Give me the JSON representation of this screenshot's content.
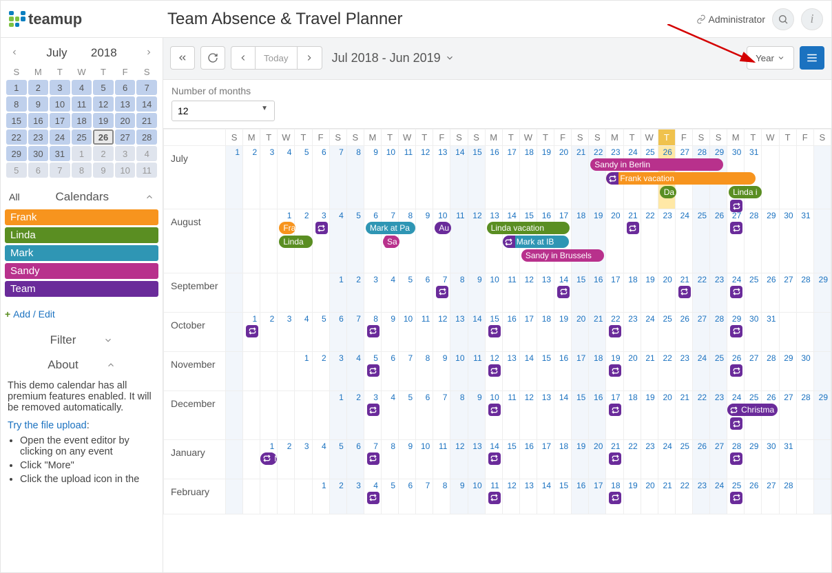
{
  "brand": "teamup",
  "title": "Team Absence & Travel Planner",
  "admin_label": "Administrator",
  "toolbar": {
    "today": "Today",
    "range": "Jul 2018 - Jun 2019",
    "view": "Year"
  },
  "months_bar": {
    "label": "Number of months",
    "value": "12"
  },
  "mini_cal": {
    "month": "July",
    "year": "2018",
    "dow": [
      "S",
      "M",
      "T",
      "W",
      "T",
      "F",
      "S"
    ],
    "weeks": [
      [
        {
          "n": 1,
          "c": "in"
        },
        {
          "n": 2,
          "c": "in"
        },
        {
          "n": 3,
          "c": "in"
        },
        {
          "n": 4,
          "c": "in"
        },
        {
          "n": 5,
          "c": "in"
        },
        {
          "n": 6,
          "c": "in"
        },
        {
          "n": 7,
          "c": "in"
        }
      ],
      [
        {
          "n": 8,
          "c": "in"
        },
        {
          "n": 9,
          "c": "in"
        },
        {
          "n": 10,
          "c": "in"
        },
        {
          "n": 11,
          "c": "in"
        },
        {
          "n": 12,
          "c": "in"
        },
        {
          "n": 13,
          "c": "in"
        },
        {
          "n": 14,
          "c": "in"
        }
      ],
      [
        {
          "n": 15,
          "c": "in"
        },
        {
          "n": 16,
          "c": "in"
        },
        {
          "n": 17,
          "c": "in"
        },
        {
          "n": 18,
          "c": "in"
        },
        {
          "n": 19,
          "c": "in"
        },
        {
          "n": 20,
          "c": "in"
        },
        {
          "n": 21,
          "c": "in"
        }
      ],
      [
        {
          "n": 22,
          "c": "in"
        },
        {
          "n": 23,
          "c": "in"
        },
        {
          "n": 24,
          "c": "in"
        },
        {
          "n": 25,
          "c": "in"
        },
        {
          "n": 26,
          "c": "today"
        },
        {
          "n": 27,
          "c": "in"
        },
        {
          "n": 28,
          "c": "in"
        }
      ],
      [
        {
          "n": 29,
          "c": "in"
        },
        {
          "n": 30,
          "c": "in"
        },
        {
          "n": 31,
          "c": "in"
        },
        {
          "n": 1,
          "c": "out"
        },
        {
          "n": 2,
          "c": "out"
        },
        {
          "n": 3,
          "c": "out"
        },
        {
          "n": 4,
          "c": "out"
        }
      ],
      [
        {
          "n": 5,
          "c": "out"
        },
        {
          "n": 6,
          "c": "out"
        },
        {
          "n": 7,
          "c": "out"
        },
        {
          "n": 8,
          "c": "out"
        },
        {
          "n": 9,
          "c": "out"
        },
        {
          "n": 10,
          "c": "out"
        },
        {
          "n": 11,
          "c": "out"
        }
      ]
    ]
  },
  "calendars_label": "Calendars",
  "all_label": "All",
  "calendars": [
    {
      "name": "Frank",
      "cls": "cal-frank"
    },
    {
      "name": "Linda",
      "cls": "cal-linda"
    },
    {
      "name": "Mark",
      "cls": "cal-mark"
    },
    {
      "name": "Sandy",
      "cls": "cal-sandy"
    },
    {
      "name": "Team",
      "cls": "cal-team"
    }
  ],
  "add_edit": "Add / Edit",
  "filter_label": "Filter",
  "about_label": "About",
  "about_text": "This demo calendar has all premium features enabled. It will be removed automatically.",
  "about_link": "Try the file upload",
  "about_items": [
    "Open the event editor by clicking on any event",
    "Click \"More\"",
    "Click the upload icon in the"
  ],
  "dow_header": [
    "S",
    "M",
    "T",
    "W",
    "T",
    "F",
    "S",
    "S",
    "M",
    "T",
    "W",
    "T",
    "F",
    "S",
    "S",
    "M",
    "T",
    "W",
    "T",
    "F",
    "S",
    "S",
    "M",
    "T",
    "W",
    "T",
    "F",
    "S",
    "S",
    "M",
    "T",
    "W",
    "T",
    "F",
    "S"
  ],
  "year_rows": [
    {
      "month": "July",
      "offset": 0,
      "days": 31,
      "today": 26,
      "tall": 3.2,
      "events": [
        {
          "label": "Sandy in Berlin",
          "start": 22,
          "span": 8,
          "row": 0,
          "color": "#b8318c"
        },
        {
          "label": "Frank vacation",
          "start": 23,
          "span": 9,
          "row": 1,
          "color": "#f7941e",
          "prependRpt": true
        },
        {
          "label": "Da",
          "start": 26,
          "span": 1,
          "row": 2,
          "color": "#5a8e22"
        },
        {
          "label": "Linda i",
          "start": 30,
          "span": 2,
          "row": 2,
          "color": "#5a8e22"
        }
      ],
      "rpt": [
        {
          "col": 30,
          "row": 3
        }
      ]
    },
    {
      "month": "August",
      "offset": 3,
      "days": 31,
      "today": null,
      "tall": 3.2,
      "events": [
        {
          "label": "Fra",
          "start": 1,
          "span": 1,
          "row": 0,
          "color": "#f7941e"
        },
        {
          "label": "Linda",
          "start": 1,
          "span": 2,
          "row": 1,
          "color": "#5a8e22"
        },
        {
          "label": "Mark at Pa",
          "start": 6,
          "span": 3,
          "row": 0,
          "color": "#2f96b4"
        },
        {
          "label": "Sa",
          "start": 7,
          "span": 1,
          "row": 1,
          "color": "#b8318c"
        },
        {
          "label": "Au",
          "start": 10,
          "span": 1,
          "row": 0,
          "color": "#6a2b9a"
        },
        {
          "label": "Linda vacation",
          "start": 13,
          "span": 5,
          "row": 0,
          "color": "#5a8e22"
        },
        {
          "label": "Mark at IB",
          "start": 14,
          "span": 4,
          "row": 1,
          "color": "#2f96b4",
          "prependRpt": true
        },
        {
          "label": "Sandy in Brussels",
          "start": 15,
          "span": 5,
          "row": 2,
          "color": "#b8318c"
        }
      ],
      "rpt": [
        {
          "col": 3,
          "row": 0
        },
        {
          "col": 7,
          "row": 1,
          "sandy": true
        },
        {
          "col": 21,
          "row": 0
        },
        {
          "col": 27,
          "row": 0
        }
      ]
    },
    {
      "month": "September",
      "offset": 6,
      "days": 30,
      "today": null,
      "tall": 1.6,
      "rpt": [
        {
          "col": 7,
          "row": 0
        },
        {
          "col": 14,
          "row": 0
        },
        {
          "col": 21,
          "row": 0
        },
        {
          "col": 24,
          "row": 0
        }
      ]
    },
    {
      "month": "October",
      "offset": 1,
      "days": 31,
      "today": null,
      "tall": 1.6,
      "rpt": [
        {
          "col": 1,
          "row": 0
        },
        {
          "col": 8,
          "row": 0
        },
        {
          "col": 15,
          "row": 0
        },
        {
          "col": 22,
          "row": 0
        },
        {
          "col": 29,
          "row": 0
        }
      ]
    },
    {
      "month": "November",
      "offset": 4,
      "days": 30,
      "today": null,
      "tall": 1.6,
      "rpt": [
        {
          "col": 5,
          "row": 0
        },
        {
          "col": 12,
          "row": 0
        },
        {
          "col": 19,
          "row": 0
        },
        {
          "col": 26,
          "row": 0
        }
      ]
    },
    {
      "month": "December",
      "offset": 6,
      "days": 31,
      "today": null,
      "tall": 2.2,
      "events": [
        {
          "label": "Christma",
          "start": 24,
          "span": 3,
          "row": 0,
          "color": "#6a2b9a",
          "prependRpt": true
        }
      ],
      "rpt": [
        {
          "col": 3,
          "row": 0
        },
        {
          "col": 10,
          "row": 0
        },
        {
          "col": 17,
          "row": 0
        },
        {
          "col": 24,
          "row": 1
        }
      ]
    },
    {
      "month": "January",
      "offset": 2,
      "days": 31,
      "today": null,
      "tall": 1.6,
      "events": [
        {
          "label": "New",
          "start": 1,
          "span": 1,
          "row": 0,
          "color": "#6a2b9a",
          "prependRpt": true
        }
      ],
      "rpt": [
        {
          "col": 7,
          "row": 0
        },
        {
          "col": 14,
          "row": 0
        },
        {
          "col": 21,
          "row": 0
        },
        {
          "col": 28,
          "row": 0
        }
      ]
    },
    {
      "month": "February",
      "offset": 5,
      "days": 28,
      "today": null,
      "tall": 1.3,
      "rpt": [
        {
          "col": 4,
          "row": 0
        },
        {
          "col": 11,
          "row": 0
        },
        {
          "col": 18,
          "row": 0
        },
        {
          "col": 25,
          "row": 0
        }
      ]
    }
  ]
}
